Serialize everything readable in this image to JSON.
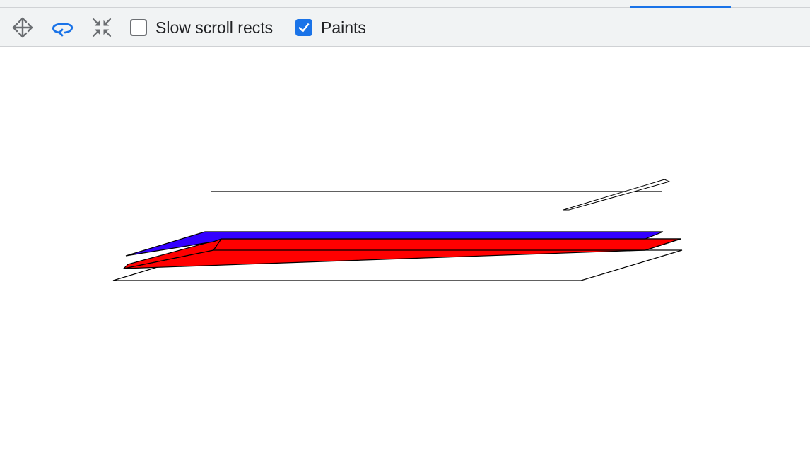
{
  "toolbar": {
    "pan_icon": "move-arrows-icon",
    "rotate_icon": "rotate-icon",
    "reset_icon": "collapse-arrows-icon",
    "slow_scroll_rects": {
      "label": "Slow scroll rects",
      "checked": false
    },
    "paints": {
      "label": "Paints",
      "checked": true
    }
  },
  "colors": {
    "accent": "#1a73e8",
    "layer_blue": "#3300ff",
    "layer_red": "#ff0000",
    "outline": "#000000"
  }
}
